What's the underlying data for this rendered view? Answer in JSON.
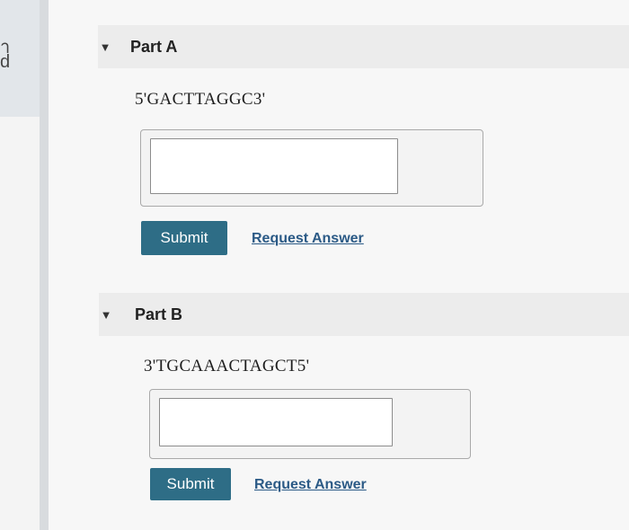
{
  "left_panel": {
    "fragment_top": "า",
    "fragment_bottom": "d"
  },
  "parts": [
    {
      "title": "Part A",
      "sequence": "5'GACTTAGGC3'",
      "answer_value": "",
      "submit_label": "Submit",
      "request_label": "Request Answer"
    },
    {
      "title": "Part B",
      "sequence": "3'TGCAAACTAGCT5'",
      "answer_value": "",
      "submit_label": "Submit",
      "request_label": "Request Answer"
    }
  ],
  "icons": {
    "expand": "caret-down-icon"
  }
}
